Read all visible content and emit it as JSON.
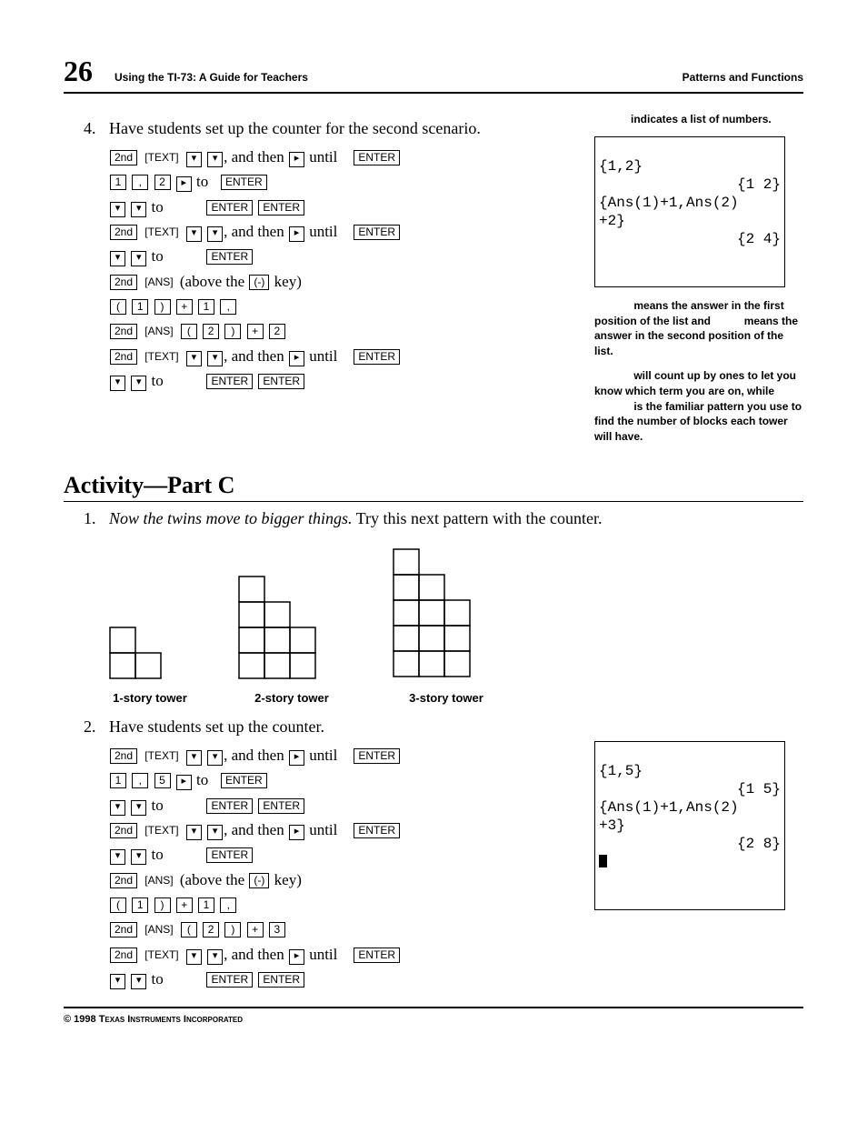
{
  "header": {
    "page_number": "26",
    "book_title": "Using the TI-73: A Guide for Teachers",
    "chapter": "Patterns and Functions"
  },
  "body": {
    "step4_num": "4.",
    "step4_text": "Have students set up the counter for the second scenario.",
    "ks1": {
      "l1_mid": ", and then",
      "l1_end": "until",
      "l2_to": "to",
      "l3_to": "to",
      "l4_mid": ", and then",
      "l4_end": "until",
      "l5_to": "to",
      "l6_txt": "(above the",
      "l6_txt2": "key)",
      "l9_mid": ", and then",
      "l9_end": "until",
      "l10_to": "to"
    },
    "section_c_title": "Activity—Part C",
    "c1_num": "1.",
    "c1_italic": "Now the twins move to bigger things.",
    "c1_rest": " Try this next pattern with the counter.",
    "tower_labels": {
      "t1": "1-story tower",
      "t2": "2-story tower",
      "t3": "3-story tower"
    },
    "c2_num": "2.",
    "c2_text": "Have students set up the counter.",
    "ks2": {
      "l1_mid": ", and then",
      "l1_end": "until",
      "l2_to": "to",
      "l3_to": "to",
      "l4_mid": ", and then",
      "l4_end": "until",
      "l5_to": "to",
      "l6_txt": "(above the",
      "l6_txt2": "key)",
      "l9_mid": ", and then",
      "l9_end": "until",
      "l10_to": "to"
    }
  },
  "keys": {
    "second": "2nd",
    "text": "[TEXT]",
    "ans": "[ANS]",
    "enter": "ENTER",
    "one": "1",
    "two": "2",
    "three": "3",
    "five": "5",
    "comma": ",",
    "lparen": "(",
    "rparen": ")",
    "plus": "+",
    "neg": "(-)",
    "down": "▾",
    "right": "▸"
  },
  "sidebar": {
    "note1": "indicates a list of numbers.",
    "calc1": {
      "l1": "{1,2}",
      "l2": "            {1 2}",
      "l3": "{Ans(1)+1,Ans(2)",
      "l4": "+2}",
      "l5": "            {2 4}"
    },
    "note2a": "means the answer in the first position of the list and",
    "note2b": "means the answer in the second position of the list.",
    "note3a": "will count up by ones to let you know which term you are on, while",
    "note3b": "is the familiar pattern you use to find the number of blocks each tower will have.",
    "calc2": {
      "l1": "{1,5}",
      "l2": "            {1 5}",
      "l3": "{Ans(1)+1,Ans(2)",
      "l4": "+3}",
      "l5": "            {2 8}"
    }
  },
  "footer": {
    "copyright": "© 1998 Texas Instruments Incorporated"
  }
}
